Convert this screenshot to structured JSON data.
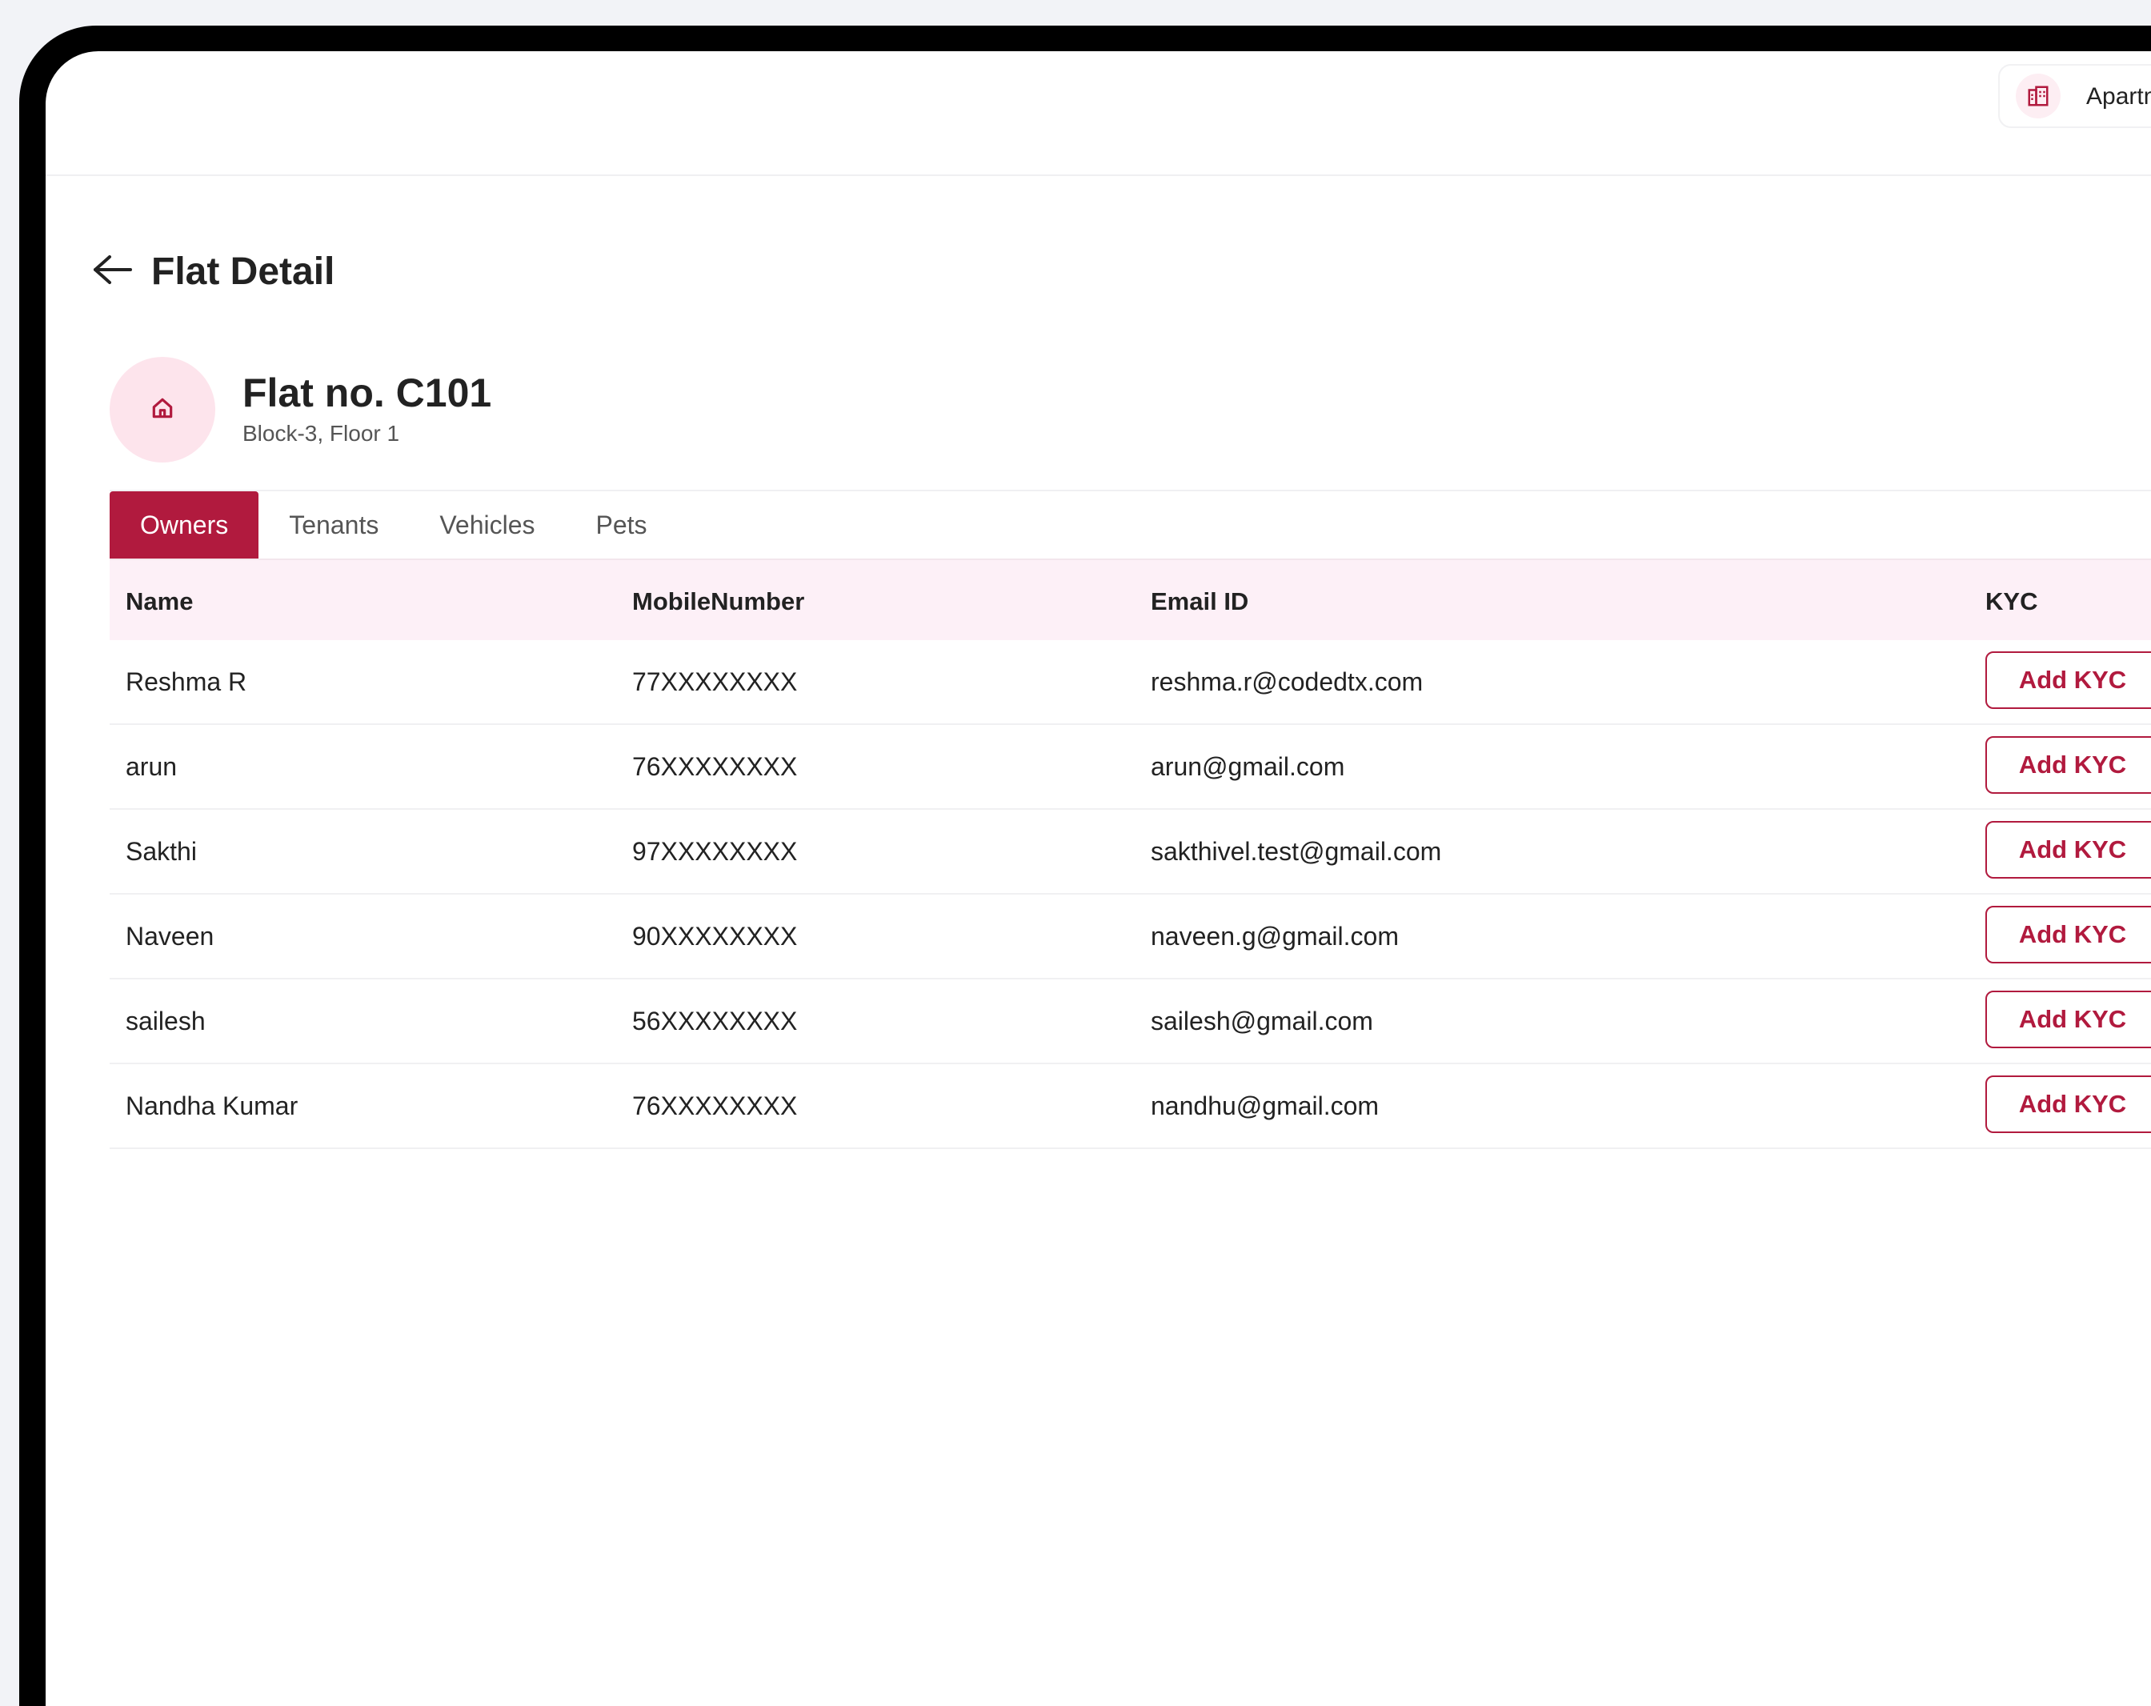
{
  "header": {
    "app_switch_label": "Apartment"
  },
  "page": {
    "title": "Flat Detail"
  },
  "flat": {
    "number": "Flat no. C101",
    "location": "Block-3, Floor 1"
  },
  "tabs": [
    {
      "label": "Owners",
      "active": true
    },
    {
      "label": "Tenants",
      "active": false
    },
    {
      "label": "Vehicles",
      "active": false
    },
    {
      "label": "Pets",
      "active": false
    }
  ],
  "table": {
    "headers": {
      "name": "Name",
      "mobile": "MobileNumber",
      "email": "Email ID",
      "kyc": "KYC"
    },
    "rows": [
      {
        "name": "Reshma R",
        "mobile": "77XXXXXXXX",
        "email": "reshma.r@codedtx.com",
        "kyc_label": "Add KYC"
      },
      {
        "name": "arun",
        "mobile": "76XXXXXXXX",
        "email": "arun@gmail.com",
        "kyc_label": "Add KYC"
      },
      {
        "name": "Sakthi",
        "mobile": "97XXXXXXXX",
        "email": "sakthivel.test@gmail.com",
        "kyc_label": "Add KYC"
      },
      {
        "name": "Naveen",
        "mobile": "90XXXXXXXX",
        "email": "naveen.g@gmail.com",
        "kyc_label": "Add KYC"
      },
      {
        "name": "sailesh",
        "mobile": "56XXXXXXXX",
        "email": "sailesh@gmail.com",
        "kyc_label": "Add KYC"
      },
      {
        "name": "Nandha Kumar",
        "mobile": "76XXXXXXXX",
        "email": "nandhu@gmail.com",
        "kyc_label": "Add KYC"
      }
    ]
  },
  "colors": {
    "accent": "#b11a3e",
    "header_row_bg": "#fdf0f7",
    "avatar_bg": "#fde4ec"
  },
  "icons": {
    "app_switch": "building-icon",
    "back": "arrow-left-icon",
    "flat": "home-icon"
  }
}
